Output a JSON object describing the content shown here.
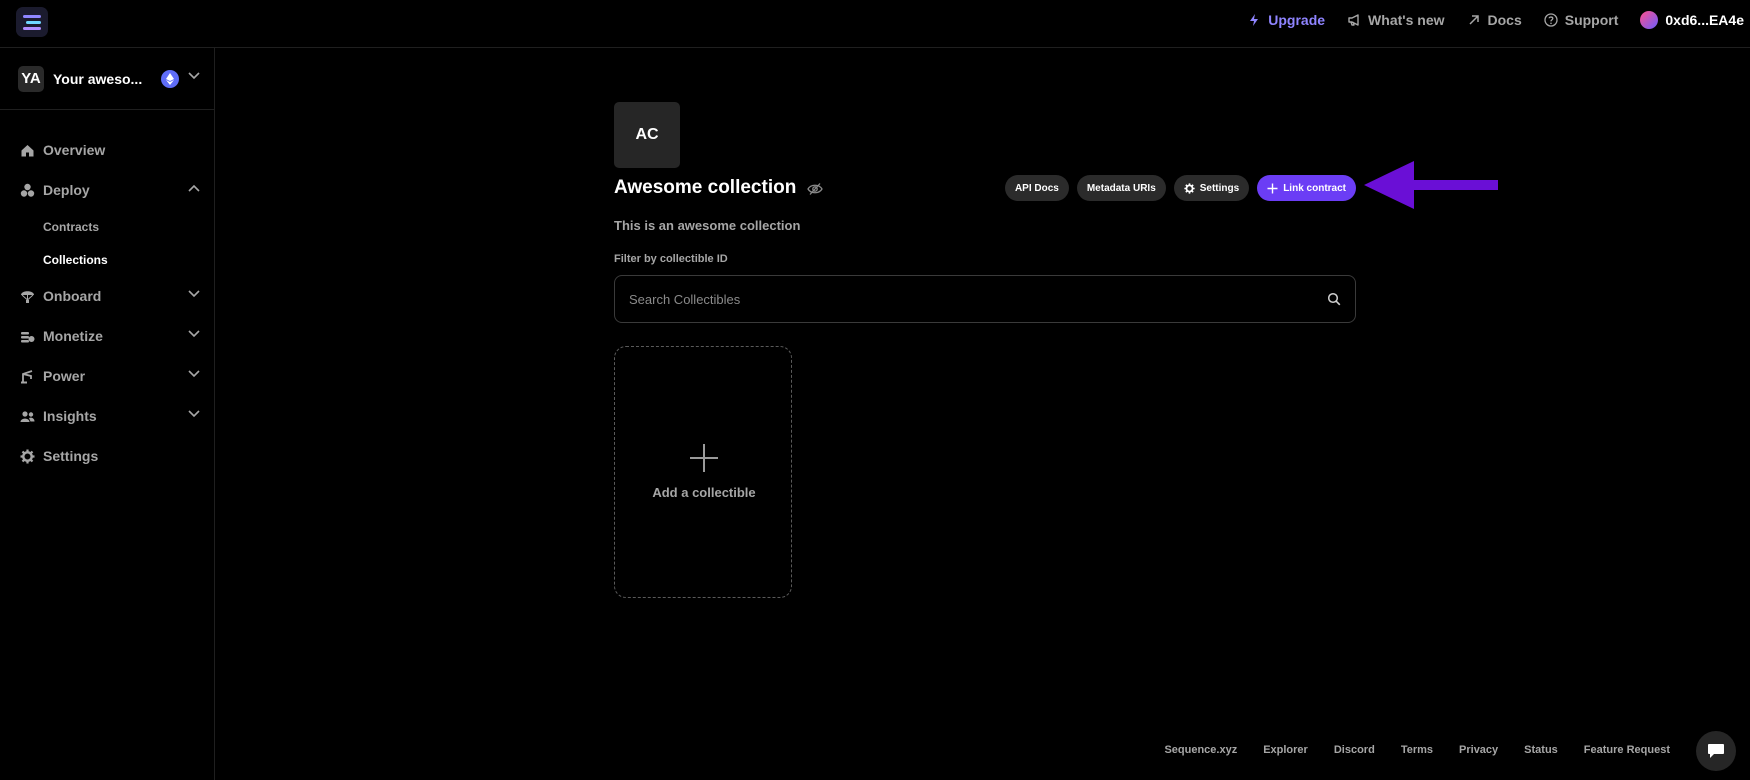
{
  "topbar": {
    "upgrade": "Upgrade",
    "whats_new": "What's new",
    "docs": "Docs",
    "support": "Support",
    "wallet": "0xd6...EA4e"
  },
  "sidebar": {
    "project_badge": "YA",
    "project_name": "Your aweso...",
    "items": [
      {
        "label": "Overview",
        "icon": "home-icon"
      },
      {
        "label": "Deploy",
        "icon": "cubes-icon",
        "expanded": true,
        "children": [
          "Contracts",
          "Collections"
        ]
      },
      {
        "label": "Onboard",
        "icon": "parachute-icon"
      },
      {
        "label": "Monetize",
        "icon": "coins-icon"
      },
      {
        "label": "Power",
        "icon": "crane-icon"
      },
      {
        "label": "Insights",
        "icon": "users-icon"
      },
      {
        "label": "Settings",
        "icon": "gear-icon"
      }
    ],
    "active_child": "Collections"
  },
  "collection": {
    "avatar": "AC",
    "title": "Awesome collection",
    "description": "This is an awesome collection",
    "actions": {
      "api_docs": "API Docs",
      "metadata_uris": "Metadata URIs",
      "settings": "Settings",
      "link_contract": "Link contract"
    },
    "filter_label": "Filter by collectible ID",
    "search_placeholder": "Search Collectibles",
    "add_collectible": "Add a collectible"
  },
  "footer": {
    "links": [
      "Sequence.xyz",
      "Explorer",
      "Discord",
      "Terms",
      "Privacy",
      "Status",
      "Feature Request"
    ]
  },
  "colors": {
    "accent": "#6b3df5",
    "upgrade": "#8f84ff",
    "annotation_arrow": "#6a0fd6"
  }
}
